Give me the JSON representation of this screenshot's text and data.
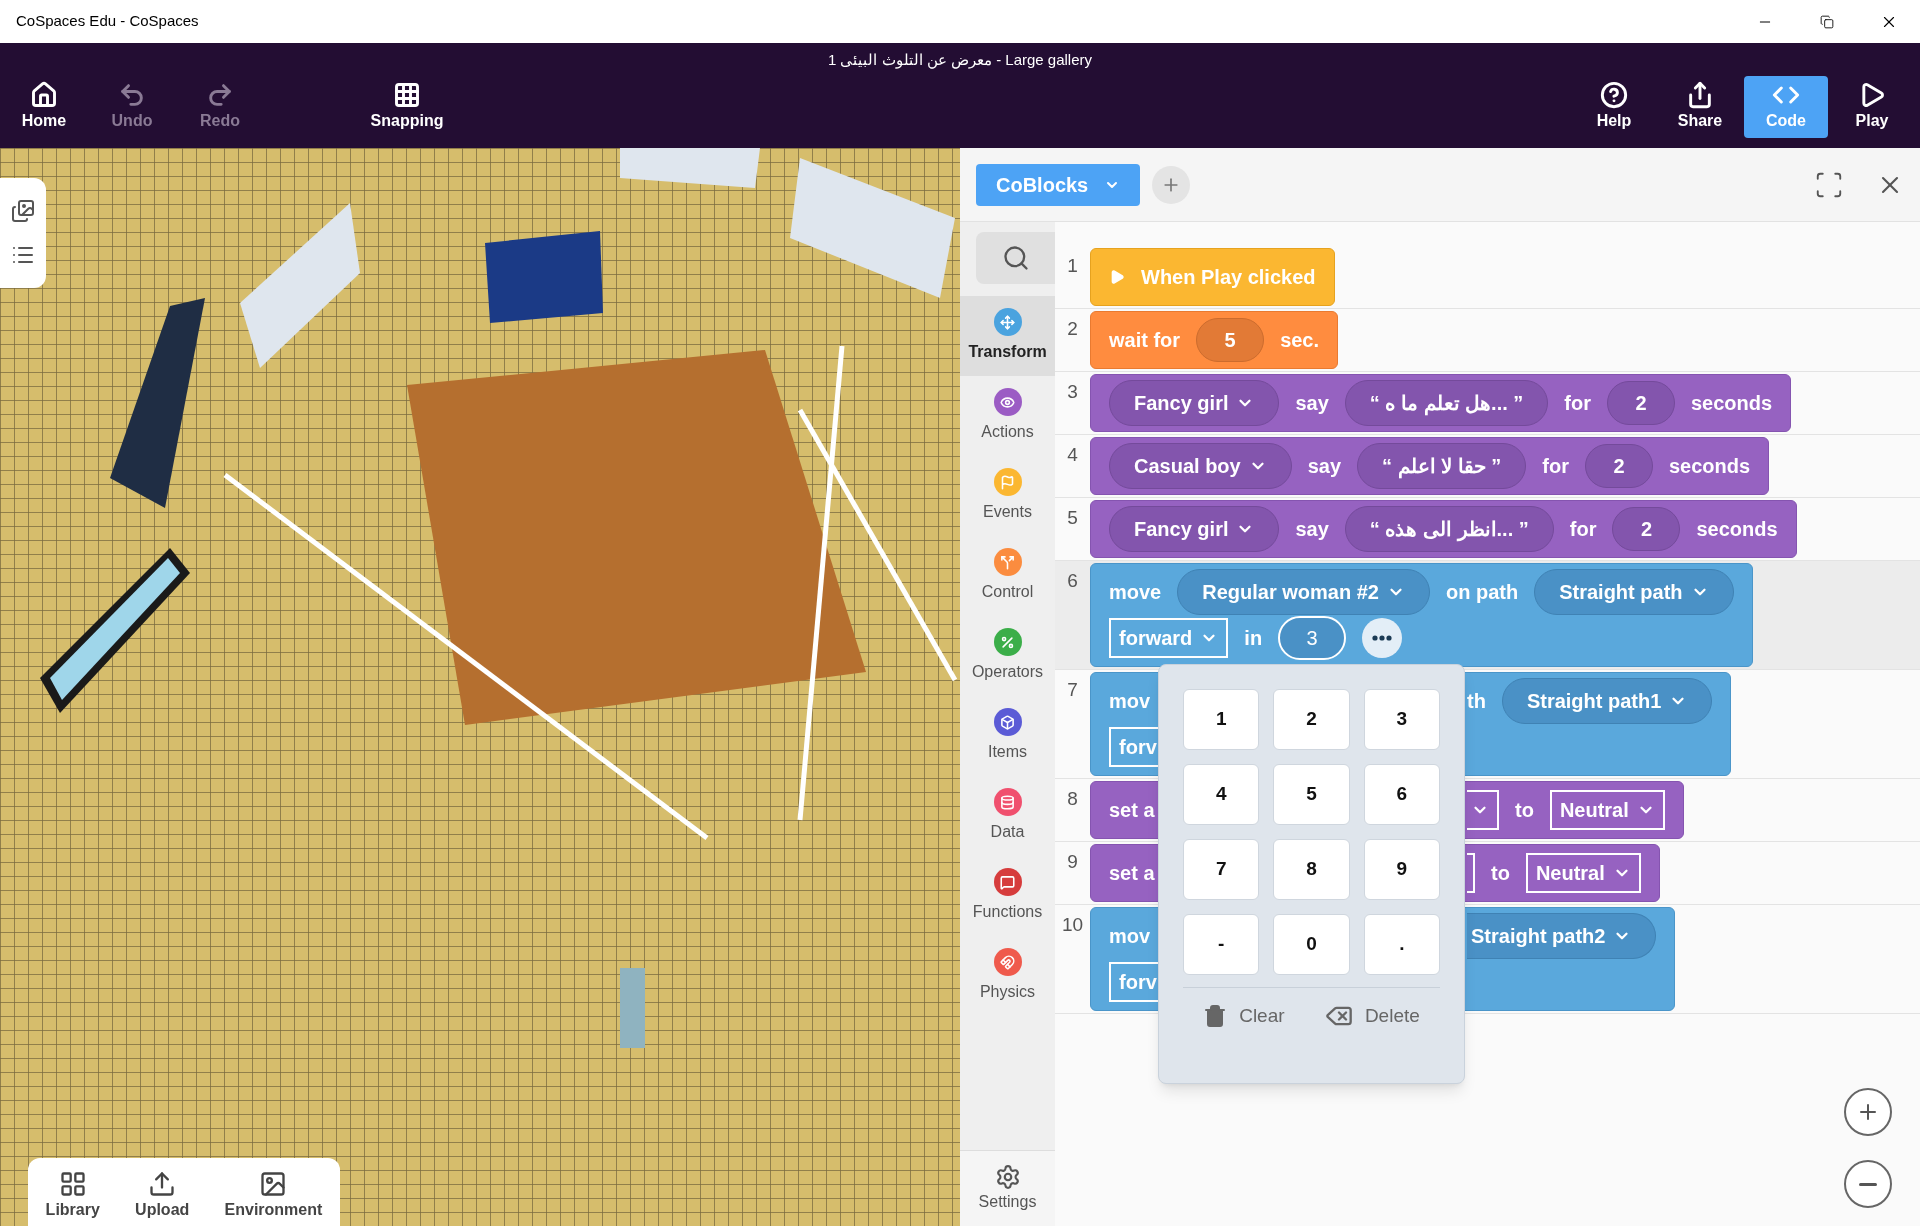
{
  "window": {
    "title": "CoSpaces Edu - CoSpaces"
  },
  "toolbar": {
    "title": "معرض عن التلوث البيئى 1 - Large gallery",
    "left": [
      {
        "kind": "home",
        "label": "Home",
        "disabled": false
      },
      {
        "kind": "undo",
        "label": "Undo",
        "disabled": true
      },
      {
        "kind": "redo",
        "label": "Redo",
        "disabled": true
      },
      {
        "kind": "grid",
        "label": "Snapping",
        "disabled": false
      }
    ],
    "right": [
      {
        "kind": "help",
        "label": "Help",
        "selected": false
      },
      {
        "kind": "share",
        "label": "Share",
        "selected": false
      },
      {
        "kind": "code",
        "label": "Code",
        "selected": true
      },
      {
        "kind": "play",
        "label": "Play",
        "selected": false
      }
    ]
  },
  "bottom_tabs": [
    {
      "kind": "library",
      "label": "Library"
    },
    {
      "kind": "upload",
      "label": "Upload"
    },
    {
      "kind": "environment",
      "label": "Environment"
    }
  ],
  "code_panel": {
    "language": "CoBlocks",
    "categories": [
      {
        "label": "Transform",
        "color": "#4aa3df",
        "kind": "transform",
        "selected": true
      },
      {
        "label": "Actions",
        "color": "#9b5cc4",
        "kind": "actions",
        "selected": false
      },
      {
        "label": "Events",
        "color": "#fbb731",
        "kind": "events",
        "selected": false
      },
      {
        "label": "Control",
        "color": "#fb8c3f",
        "kind": "control",
        "selected": false
      },
      {
        "label": "Operators",
        "color": "#3bae49",
        "kind": "operators",
        "selected": false
      },
      {
        "label": "Items",
        "color": "#5b5bd6",
        "kind": "items",
        "selected": false
      },
      {
        "label": "Data",
        "color": "#f0506e",
        "kind": "data",
        "selected": false
      },
      {
        "label": "Functions",
        "color": "#d63c3c",
        "kind": "functions",
        "selected": false
      },
      {
        "label": "Physics",
        "color": "#ef5a4c",
        "kind": "physics",
        "selected": false
      }
    ],
    "settings": "Settings",
    "lines": [
      {
        "number": "1",
        "kind": "hat",
        "selected": false,
        "rows": [
          {
            "parts": [
              {
                "kind": "label",
                "text": "When Play clicked"
              }
            ]
          }
        ]
      },
      {
        "number": "2",
        "kind": "control",
        "selected": false,
        "rows": [
          {
            "parts": [
              {
                "kind": "label",
                "text": "wait for"
              },
              {
                "kind": "number",
                "text": "5",
                "focused": false
              },
              {
                "kind": "label",
                "text": "sec."
              }
            ]
          }
        ]
      },
      {
        "number": "3",
        "kind": "actions",
        "selected": false,
        "rows": [
          {
            "parts": [
              {
                "kind": "dropdown",
                "text": "Fancy girl"
              },
              {
                "kind": "label",
                "text": "say"
              },
              {
                "kind": "string",
                "text": "“ هل تعلم ما ه... ”"
              },
              {
                "kind": "label",
                "text": "for"
              },
              {
                "kind": "number",
                "text": "2",
                "focused": false
              },
              {
                "kind": "label",
                "text": "seconds"
              }
            ]
          }
        ]
      },
      {
        "number": "4",
        "kind": "actions",
        "selected": false,
        "rows": [
          {
            "parts": [
              {
                "kind": "dropdown",
                "text": "Casual boy"
              },
              {
                "kind": "label",
                "text": "say"
              },
              {
                "kind": "string",
                "text": "“ حقا لا اعلم ”"
              },
              {
                "kind": "label",
                "text": "for"
              },
              {
                "kind": "number",
                "text": "2",
                "focused": false
              },
              {
                "kind": "label",
                "text": "seconds"
              }
            ]
          }
        ]
      },
      {
        "number": "5",
        "kind": "actions",
        "selected": false,
        "rows": [
          {
            "parts": [
              {
                "kind": "dropdown",
                "text": "Fancy girl"
              },
              {
                "kind": "label",
                "text": "say"
              },
              {
                "kind": "string",
                "text": "“ انظر الى هذه... ”"
              },
              {
                "kind": "label",
                "text": "for"
              },
              {
                "kind": "number",
                "text": "2",
                "focused": false
              },
              {
                "kind": "label",
                "text": "seconds"
              }
            ]
          }
        ]
      },
      {
        "number": "6",
        "kind": "transform",
        "selected": true,
        "rows": [
          {
            "parts": [
              {
                "kind": "label",
                "text": "move"
              },
              {
                "kind": "dropdown",
                "text": "Regular woman #2"
              },
              {
                "kind": "label",
                "text": "on path"
              },
              {
                "kind": "dropdown",
                "text": "Straight path"
              }
            ]
          },
          {
            "parts": [
              {
                "kind": "box",
                "text": "forward"
              },
              {
                "kind": "label",
                "text": "in"
              },
              {
                "kind": "number",
                "text": "3",
                "focused": true
              },
              {
                "kind": "more"
              }
            ]
          }
        ]
      },
      {
        "number": "7",
        "kind": "transform",
        "selected": false,
        "rows": [
          {
            "left": [
              {
                "kind": "label",
                "text": "mov"
              }
            ],
            "right": [
              {
                "kind": "label",
                "text": "th"
              },
              {
                "kind": "dropdown",
                "text": "Straight path1"
              }
            ]
          },
          {
            "left": [
              {
                "kind": "box-cut",
                "text": "forv"
              }
            ],
            "right": []
          }
        ]
      },
      {
        "number": "8",
        "kind": "actions",
        "selected": false,
        "rows": [
          {
            "left": [
              {
                "kind": "label",
                "text": "set a"
              }
            ],
            "right": [
              {
                "kind": "box-chevron"
              },
              {
                "kind": "label",
                "text": "to"
              },
              {
                "kind": "box",
                "text": "Neutral"
              }
            ]
          }
        ]
      },
      {
        "number": "9",
        "kind": "actions",
        "selected": false,
        "rows": [
          {
            "left": [
              {
                "kind": "label",
                "text": "set a"
              }
            ],
            "right": [
              {
                "kind": "box-edge"
              },
              {
                "kind": "label",
                "text": "to"
              },
              {
                "kind": "box",
                "text": "Neutral"
              }
            ]
          }
        ]
      },
      {
        "number": "10",
        "kind": "transform",
        "selected": false,
        "rows": [
          {
            "left": [
              {
                "kind": "label",
                "text": "mov"
              }
            ],
            "right": [
              {
                "kind": "dropdown-cut",
                "text": "Straight path2"
              }
            ]
          },
          {
            "left": [
              {
                "kind": "box-cut",
                "text": "forv"
              }
            ],
            "right": []
          }
        ]
      }
    ],
    "keypad": {
      "keys": [
        "1",
        "2",
        "3",
        "4",
        "5",
        "6",
        "7",
        "8",
        "9",
        "-",
        "0",
        "."
      ],
      "clear": "Clear",
      "delete": "Delete"
    }
  }
}
